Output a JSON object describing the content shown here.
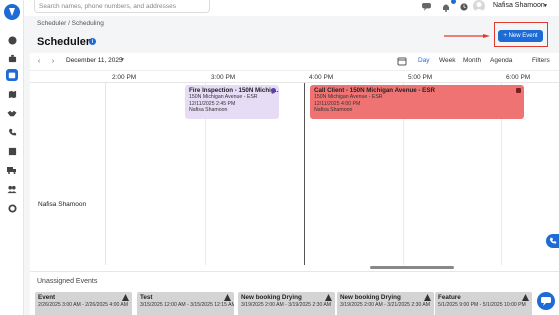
{
  "search": {
    "placeholder": "Search names, phone numbers, and addresses"
  },
  "user": {
    "name": "Nafisa Shamoon"
  },
  "breadcrumb": "Scheduler / Scheduling",
  "page": {
    "title": "Scheduler",
    "info_symbol": "i"
  },
  "new_event_label": "+ New Event",
  "toolbar": {
    "prev": "‹",
    "next": "›",
    "date": "December 11, 2025",
    "views": [
      "Day",
      "Week",
      "Month",
      "Agenda"
    ],
    "active_view": "Day",
    "filters": "Filters"
  },
  "times": [
    "2:00 PM",
    "3:00 PM",
    "4:00 PM",
    "5:00 PM",
    "6:00 PM"
  ],
  "resource": "Nafisa Shamoon",
  "events": [
    {
      "title": "Fire Inspection - 150N Michig…",
      "address": "150N Michigan Avenue - ESR",
      "datetime": "12/11/2025 2:45 PM",
      "person": "Nafisa Shamoon",
      "color": "#e6dcf5"
    },
    {
      "title": "Call Client - 150N Michigan Avenue - ESR",
      "address": "150N Michigan Avenue - ESR",
      "datetime": "12/11/2025 4:00 PM",
      "person": "Nafisa Shamoon",
      "color": "#f07373"
    }
  ],
  "unassigned": {
    "title": "Unassigned Events",
    "cards": [
      {
        "title": "Event",
        "time": "2/26/2025 3:00 AM - 2/26/2025 4:00 AM"
      },
      {
        "title": "Test",
        "time": "3/15/2025 12:00 AM - 3/15/2025 12:15 AM"
      },
      {
        "title": "New booking Drying",
        "time": "3/19/2025 2:00 AM - 3/19/2025 2:30 AM"
      },
      {
        "title": "New booking Drying",
        "time": "3/19/2025 2:00 AM - 3/21/2025 2:30 AM"
      },
      {
        "title": "Feature",
        "time": "5/1/2025 9:00 PM - 5/1/2025 10:00 PM"
      }
    ]
  },
  "colors": {
    "accent": "#1e6bd6",
    "highlight": "#e33a2f"
  }
}
